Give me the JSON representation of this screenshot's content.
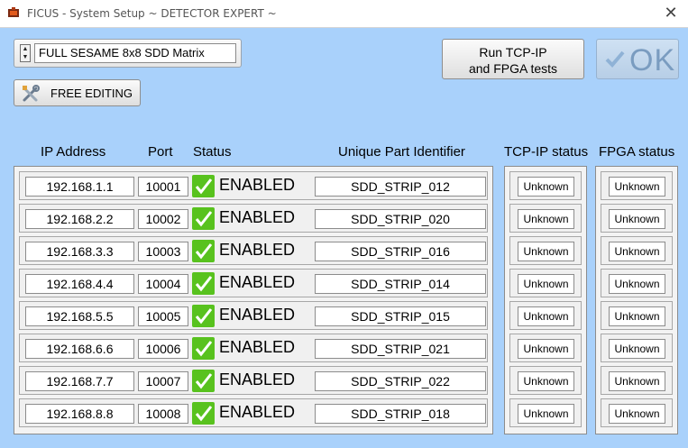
{
  "window": {
    "title": "FICUS - System Setup ~ DETECTOR EXPERT ~",
    "close_symbol": "✕"
  },
  "config": {
    "selected": "FULL SESAME 8x8 SDD Matrix"
  },
  "buttons": {
    "free_editing": "FREE EDITING",
    "run_tests_line1": "Run TCP-IP",
    "run_tests_line2": "and FPGA tests",
    "ok": "OK"
  },
  "headers": {
    "ip": "IP Address",
    "port": "Port",
    "status": "Status",
    "uid": "Unique Part Identifier",
    "tcp": "TCP-IP status",
    "fpga": "FPGA status"
  },
  "rows": [
    {
      "ip": "192.168.1.1",
      "port": "10001",
      "status": "ENABLED",
      "uid": "SDD_STRIP_012",
      "tcp": "Unknown",
      "fpga": "Unknown"
    },
    {
      "ip": "192.168.2.2",
      "port": "10002",
      "status": "ENABLED",
      "uid": "SDD_STRIP_020",
      "tcp": "Unknown",
      "fpga": "Unknown"
    },
    {
      "ip": "192.168.3.3",
      "port": "10003",
      "status": "ENABLED",
      "uid": "SDD_STRIP_016",
      "tcp": "Unknown",
      "fpga": "Unknown"
    },
    {
      "ip": "192.168.4.4",
      "port": "10004",
      "status": "ENABLED",
      "uid": "SDD_STRIP_014",
      "tcp": "Unknown",
      "fpga": "Unknown"
    },
    {
      "ip": "192.168.5.5",
      "port": "10005",
      "status": "ENABLED",
      "uid": "SDD_STRIP_015",
      "tcp": "Unknown",
      "fpga": "Unknown"
    },
    {
      "ip": "192.168.6.6",
      "port": "10006",
      "status": "ENABLED",
      "uid": "SDD_STRIP_021",
      "tcp": "Unknown",
      "fpga": "Unknown"
    },
    {
      "ip": "192.168.7.7",
      "port": "10007",
      "status": "ENABLED",
      "uid": "SDD_STRIP_022",
      "tcp": "Unknown",
      "fpga": "Unknown"
    },
    {
      "ip": "192.168.8.8",
      "port": "10008",
      "status": "ENABLED",
      "uid": "SDD_STRIP_018",
      "tcp": "Unknown",
      "fpga": "Unknown"
    }
  ],
  "colors": {
    "background": "#a9d1fb",
    "enabled_check": "#58c21e",
    "ok_text": "#7a9cc0"
  },
  "icons": {
    "app": "ficus-app-icon",
    "free_editing": "tools-icon",
    "ok": "checkmark-icon",
    "status": "checkmark-icon"
  }
}
